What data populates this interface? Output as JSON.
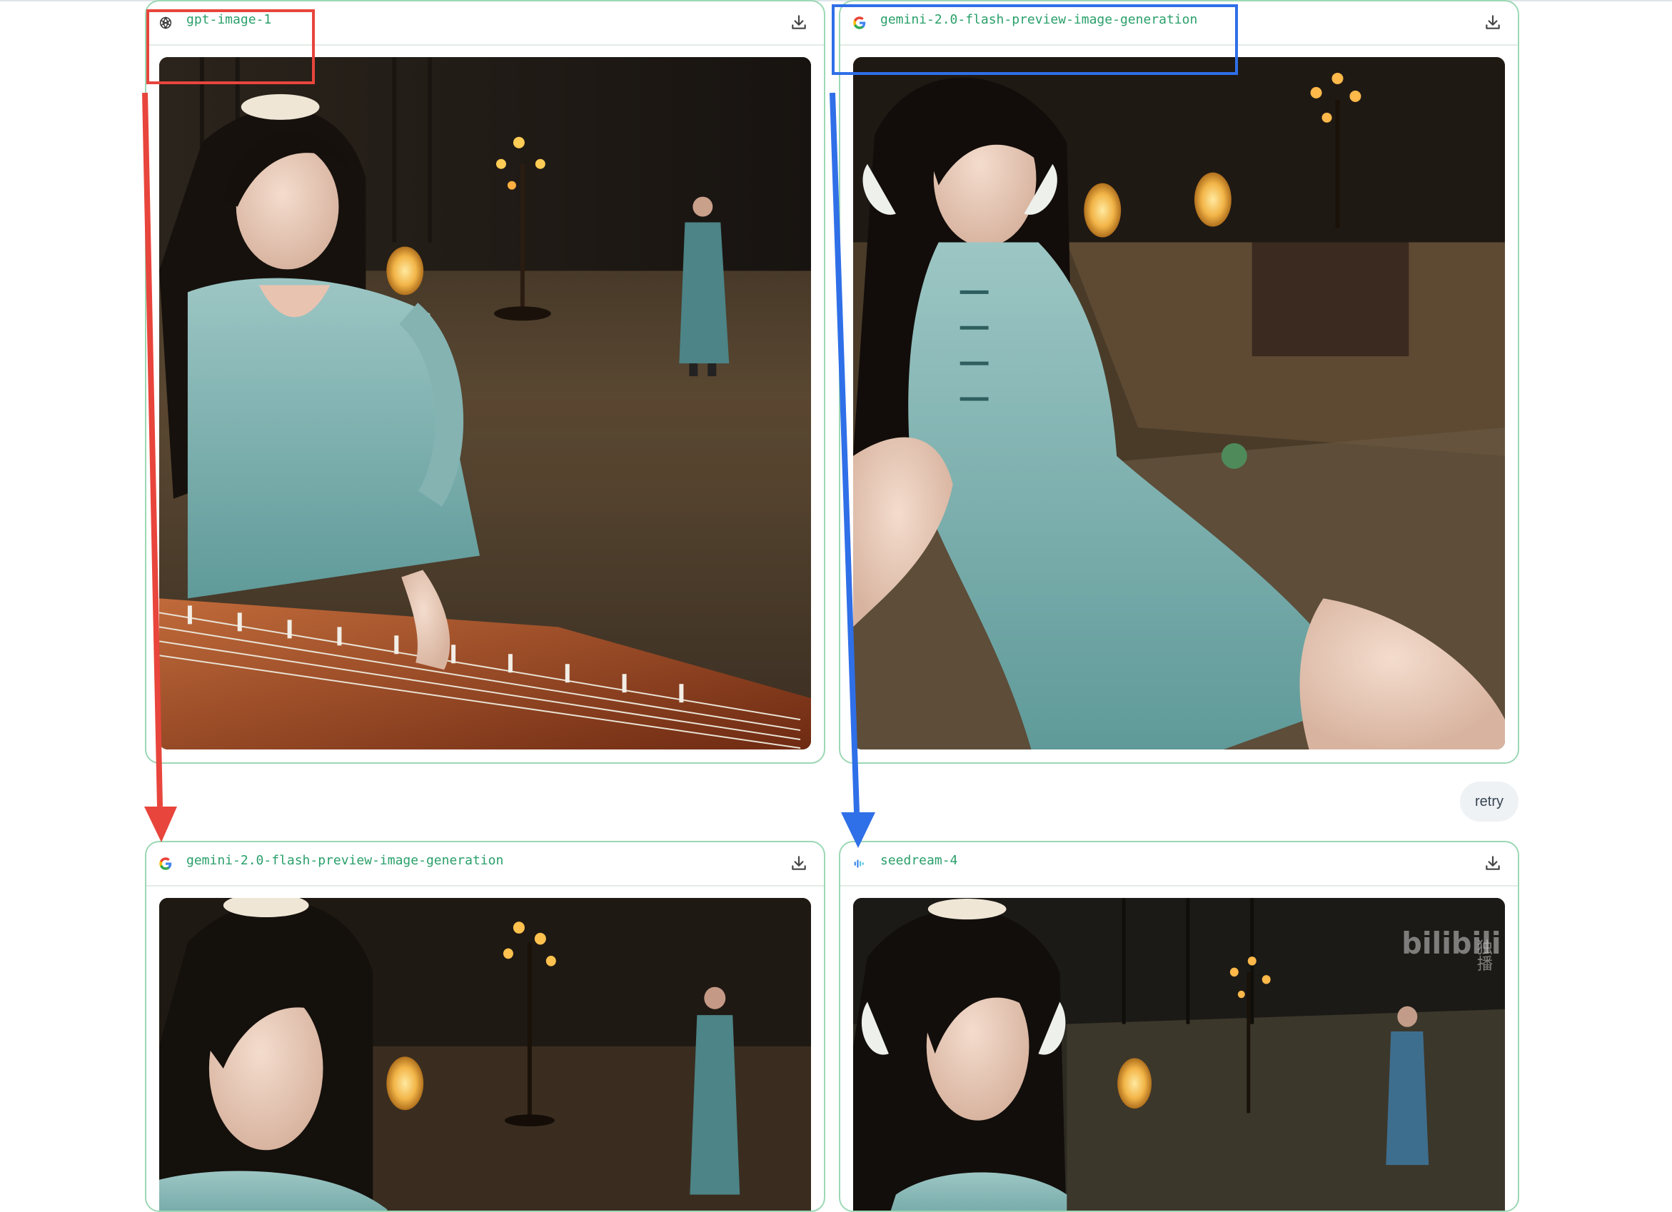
{
  "cards": [
    {
      "model": "gpt-image-1",
      "provider_icon": "openai-logo-icon"
    },
    {
      "model": "gemini-2.0-flash-preview-image-generation",
      "provider_icon": "google-g-icon"
    },
    {
      "model": "gemini-2.0-flash-preview-image-generation",
      "provider_icon": "google-g-icon"
    },
    {
      "model": "seedream-4",
      "provider_icon": "seedream-logo-icon"
    }
  ],
  "download_icon": "download-icon",
  "retry_label": "retry",
  "watermark": {
    "text": "bilibili",
    "side_text": "独播"
  },
  "annotation_colors": {
    "red": "#e8453c",
    "blue": "#2f6fe8"
  },
  "accent_color": "#2aa06a"
}
